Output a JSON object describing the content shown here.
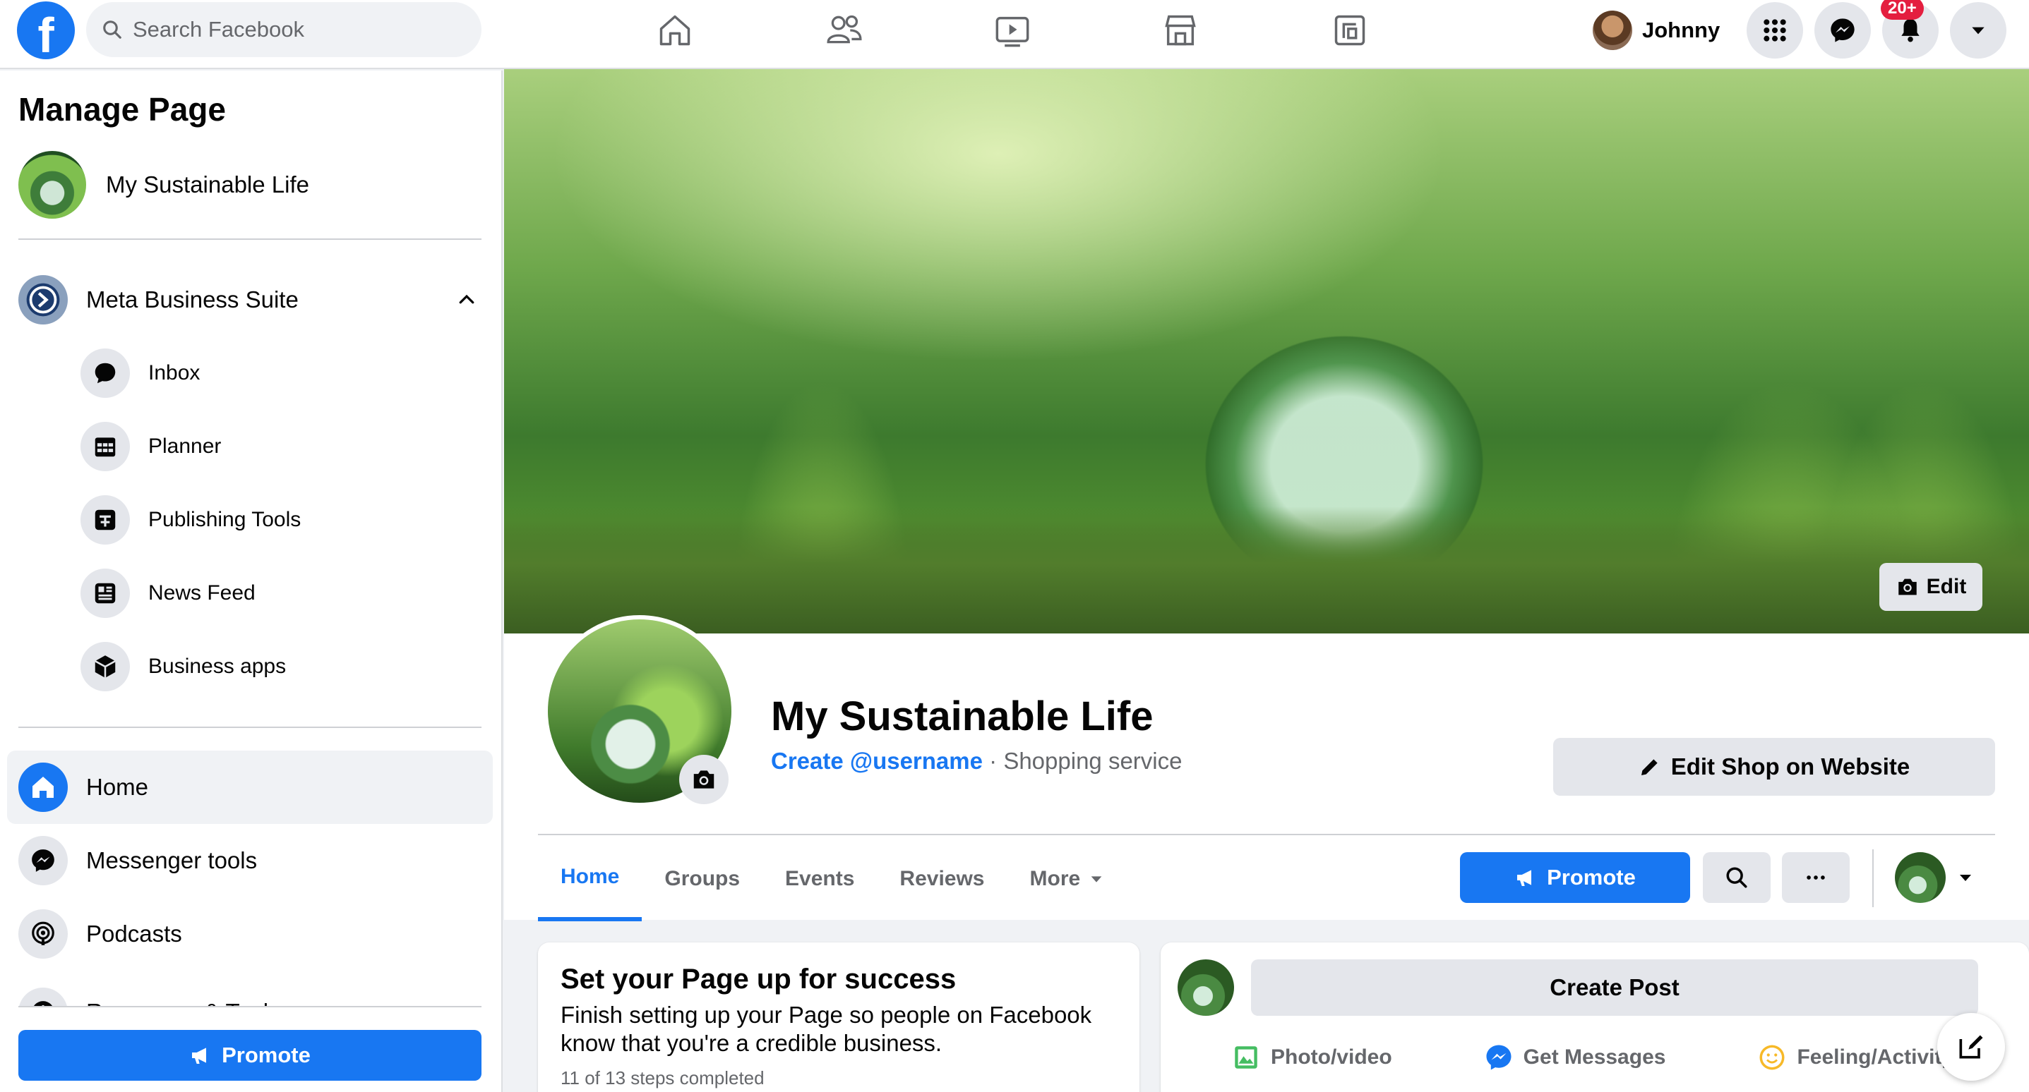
{
  "topbar": {
    "logo_letter": "f",
    "search_placeholder": "Search Facebook",
    "nav_icons": [
      "home-icon",
      "friends-icon",
      "watch-icon",
      "marketplace-icon",
      "gaming-icon"
    ],
    "user_name": "Johnny",
    "notification_badge": "20+"
  },
  "sidebar": {
    "title": "Manage Page",
    "page_name": "My Sustainable Life",
    "business_suite_label": "Meta Business Suite",
    "business_suite_items": [
      {
        "label": "Inbox",
        "icon": "chat-bubble-icon"
      },
      {
        "label": "Planner",
        "icon": "calendar-icon"
      },
      {
        "label": "Publishing Tools",
        "icon": "publishing-icon"
      },
      {
        "label": "News Feed",
        "icon": "news-feed-icon"
      },
      {
        "label": "Business apps",
        "icon": "cube-icon"
      }
    ],
    "main_items": [
      {
        "label": "Home",
        "icon": "home-icon",
        "active": true
      },
      {
        "label": "Messenger tools",
        "icon": "messenger-icon"
      },
      {
        "label": "Podcasts",
        "icon": "podcast-icon"
      },
      {
        "label": "Resources & Tools",
        "icon": "info-icon"
      }
    ],
    "promote_label": "Promote"
  },
  "cover": {
    "edit_label": "Edit"
  },
  "header": {
    "page_name": "My Sustainable Life",
    "username_link": "Create @username",
    "separator": " · ",
    "category": "Shopping service",
    "edit_shop_label": "Edit Shop on Website"
  },
  "tabs": {
    "items": [
      "Home",
      "Groups",
      "Events",
      "Reviews",
      "More"
    ],
    "active": "Home",
    "promote_label": "Promote"
  },
  "setup_card": {
    "title": "Set your Page up for success",
    "body": "Finish setting up your Page so people on Facebook know that you're a credible business.",
    "steps": "11 of 13 steps completed"
  },
  "post_card": {
    "create_post_label": "Create Post",
    "actions": [
      {
        "label": "Photo/video",
        "icon": "photo-icon",
        "color": "#45bd62"
      },
      {
        "label": "Get Messages",
        "icon": "messenger-icon",
        "color": "#1877f2"
      },
      {
        "label": "Feeling/Activity",
        "icon": "smiley-icon",
        "color": "#f7b928"
      }
    ]
  },
  "colors": {
    "accent": "#1877f2",
    "badge": "#e41e3f",
    "secondary_text": "#65676b"
  }
}
